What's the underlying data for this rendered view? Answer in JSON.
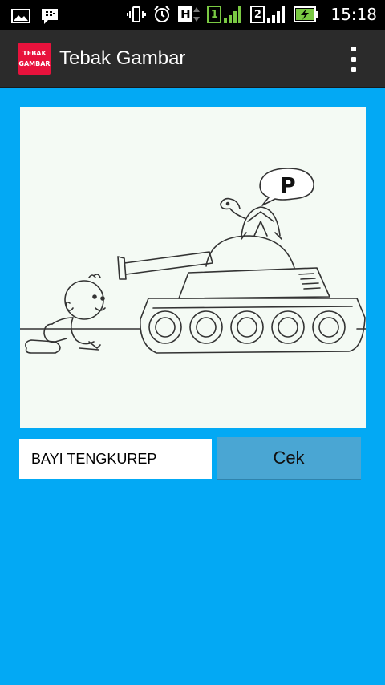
{
  "status_bar": {
    "time": "15:18",
    "network_h": "H",
    "sim1": "1",
    "sim2": "2"
  },
  "action_bar": {
    "icon_text_line1": "TEBAK",
    "icon_text_line2": "GAMBAR",
    "title": "Tebak Gambar"
  },
  "puzzle": {
    "speech_letter": "P"
  },
  "answer_input": {
    "value": "BAYI TENGKUREP"
  },
  "check_button": {
    "label": "Cek"
  },
  "colors": {
    "background": "#03a9f4",
    "action_bar": "#2b2b2b",
    "button": "#4aa6d3",
    "app_icon": "#e8123c"
  }
}
